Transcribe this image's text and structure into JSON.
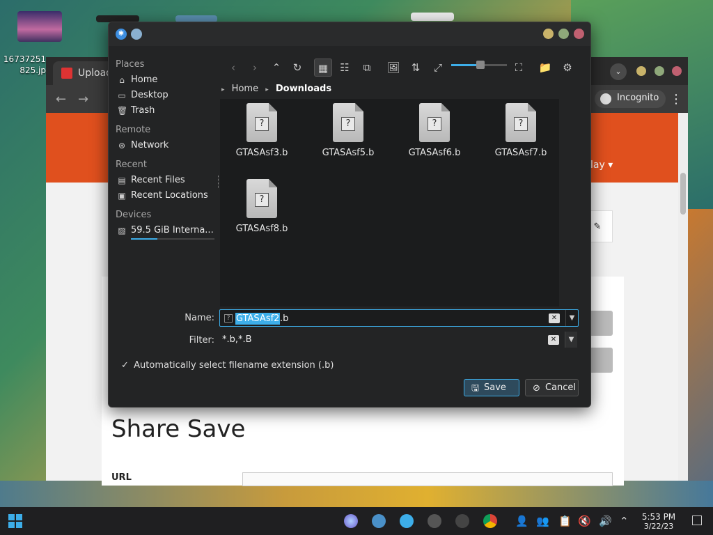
{
  "desktop": {
    "icon_label": "16737251\n825.jp"
  },
  "browser": {
    "tab_title": "Upload",
    "incognito_label": "Incognito",
    "play_label": "lay ▾",
    "share_title": "Share Save",
    "url_label": "URL"
  },
  "dialog": {
    "places": {
      "heading_places": "Places",
      "home": "Home",
      "desktop": "Desktop",
      "trash": "Trash",
      "heading_remote": "Remote",
      "network": "Network",
      "heading_recent": "Recent",
      "recent_files": "Recent Files",
      "recent_locations": "Recent Locations",
      "heading_devices": "Devices",
      "device": "59.5 GiB Interna...",
      "device_usage_fraction": 0.32
    },
    "breadcrumb": {
      "home": "Home",
      "current": "Downloads"
    },
    "files": [
      "GTASAsf3.b",
      "GTASAsf5.b",
      "GTASAsf6.b",
      "GTASAsf7.b",
      "GTASAsf8.b"
    ],
    "zoom_fraction": 0.55,
    "name_label": "Name:",
    "name_selected": "GTASAsf2",
    "name_ext": ".b",
    "filter_label": "Filter:",
    "filter_value": "*.b,*.B",
    "auto_ext_label": "Automatically select filename extension (.b)",
    "save_label": "Save",
    "cancel_label": "Cancel"
  },
  "taskbar": {
    "time": "5:53 PM",
    "date": "3/22/23"
  },
  "colors": {
    "accent": "#3daee9",
    "dialog_bg": "#232425",
    "browser_orange": "#e0501e"
  }
}
